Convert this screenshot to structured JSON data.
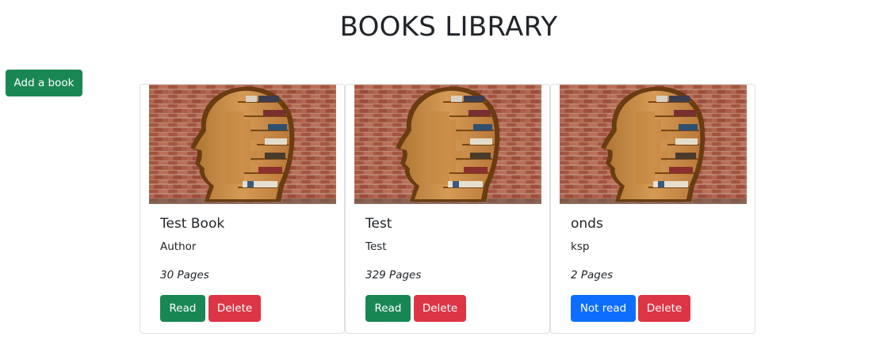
{
  "header": {
    "title": "BOOKS LIBRARY"
  },
  "toolbar": {
    "add_label": "Add a book"
  },
  "books": [
    {
      "title": "Test Book",
      "author": "Author",
      "pages": "30 Pages",
      "status_label": "Read",
      "status": "read",
      "delete_label": "Delete"
    },
    {
      "title": "Test",
      "author": "Test",
      "pages": "329 Pages",
      "status_label": "Read",
      "status": "read",
      "delete_label": "Delete"
    },
    {
      "title": "onds",
      "author": "ksp",
      "pages": "2 Pages",
      "status_label": "Not read",
      "status": "not-read",
      "delete_label": "Delete"
    }
  ],
  "colors": {
    "success": "#198754",
    "primary": "#0d6efd",
    "danger": "#dc3545",
    "text": "#212529",
    "card_border": "#dfdfdf"
  },
  "icons": {
    "card_image": "head-bookshelf-illustration"
  }
}
